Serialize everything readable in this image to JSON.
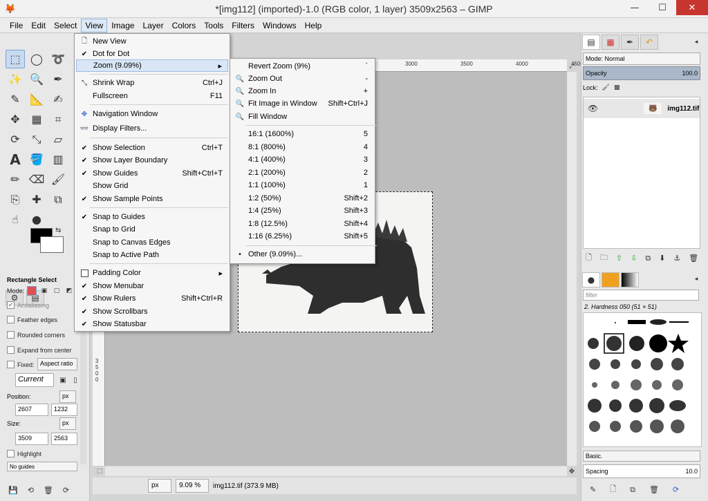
{
  "window": {
    "title": "*[img112] (imported)-1.0 (RGB color, 1 layer) 3509x2563 – GIMP",
    "app_icon": "gimp-icon"
  },
  "menubar": [
    "File",
    "Edit",
    "Select",
    "View",
    "Image",
    "Layer",
    "Colors",
    "Tools",
    "Filters",
    "Windows",
    "Help"
  ],
  "view_menu": [
    {
      "label": "New View",
      "check": "",
      "shortcut": "",
      "icon": "new-view-icon"
    },
    {
      "label": "Dot for Dot",
      "check": "✔",
      "shortcut": ""
    },
    {
      "label": "Zoom (9.09%)",
      "check": "",
      "shortcut": "",
      "submenu": true
    },
    {
      "label": "Shrink Wrap",
      "check": "",
      "shortcut": "Ctrl+J",
      "icon": "shrink-wrap-icon"
    },
    {
      "label": "Fullscreen",
      "check": "",
      "shortcut": "F11"
    },
    {
      "label": "Navigation Window",
      "check": "",
      "shortcut": "",
      "icon": "navigation-icon"
    },
    {
      "label": "Display Filters...",
      "check": "",
      "shortcut": "",
      "icon": "display-filters-icon"
    },
    {
      "label": "Show Selection",
      "check": "✔",
      "shortcut": "Ctrl+T"
    },
    {
      "label": "Show Layer Boundary",
      "check": "✔",
      "shortcut": ""
    },
    {
      "label": "Show Guides",
      "check": "✔",
      "shortcut": "Shift+Ctrl+T"
    },
    {
      "label": "Show Grid",
      "check": "",
      "shortcut": ""
    },
    {
      "label": "Show Sample Points",
      "check": "✔",
      "shortcut": ""
    },
    {
      "label": "Snap to Guides",
      "check": "✔",
      "shortcut": ""
    },
    {
      "label": "Snap to Grid",
      "check": "",
      "shortcut": ""
    },
    {
      "label": "Snap to Canvas Edges",
      "check": "",
      "shortcut": ""
    },
    {
      "label": "Snap to Active Path",
      "check": "",
      "shortcut": ""
    },
    {
      "label": "Padding Color",
      "check": "",
      "shortcut": "",
      "submenu": true
    },
    {
      "label": "Show Menubar",
      "check": "✔",
      "shortcut": ""
    },
    {
      "label": "Show Rulers",
      "check": "✔",
      "shortcut": "Shift+Ctrl+R"
    },
    {
      "label": "Show Scrollbars",
      "check": "✔",
      "shortcut": ""
    },
    {
      "label": "Show Statusbar",
      "check": "✔",
      "shortcut": ""
    }
  ],
  "zoom_menu": [
    {
      "label": "Revert Zoom (9%)",
      "shortcut": "`"
    },
    {
      "label": "Zoom Out",
      "shortcut": "-"
    },
    {
      "label": "Zoom In",
      "shortcut": "+"
    },
    {
      "label": "Fit Image in Window",
      "shortcut": "Shift+Ctrl+J"
    },
    {
      "label": "Fill Window",
      "shortcut": ""
    },
    {
      "label": "16:1  (1600%)",
      "shortcut": "5"
    },
    {
      "label": "8:1  (800%)",
      "shortcut": "4"
    },
    {
      "label": "4:1  (400%)",
      "shortcut": "3"
    },
    {
      "label": "2:1  (200%)",
      "shortcut": "2"
    },
    {
      "label": "1:1  (100%)",
      "shortcut": "1"
    },
    {
      "label": "1:2  (50%)",
      "shortcut": "Shift+2"
    },
    {
      "label": "1:4  (25%)",
      "shortcut": "Shift+3"
    },
    {
      "label": "1:8  (12.5%)",
      "shortcut": "Shift+4"
    },
    {
      "label": "1:16  (6.25%)",
      "shortcut": "Shift+5"
    },
    {
      "label": "Other (9.09%)...",
      "shortcut": "",
      "radio": "•"
    }
  ],
  "ruler": {
    "ticks": [
      "3000",
      "3500",
      "4000",
      "4500"
    ],
    "vticks": [
      "3",
      "5",
      "0",
      "0"
    ]
  },
  "tool_options": {
    "title": "Rectangle Select",
    "mode_label": "Mode:",
    "antialiasing": "Antialiasing",
    "feather": "Feather edges",
    "rounded": "Rounded corners",
    "expand": "Expand from center",
    "fixed": "Fixed:",
    "fixed_value": "Aspect ratio",
    "current": "Current",
    "position_label": "Position:",
    "pos_x": "2607",
    "pos_y": "1232",
    "size_label": "Size:",
    "size_w": "3509",
    "size_h": "2563",
    "unit": "px",
    "highlight": "Highlight",
    "guides": "No guides"
  },
  "status": {
    "unit": "px",
    "zoom": "9.09 %",
    "info": "img112.tif (373.9 MB)"
  },
  "layers": {
    "mode": "Mode: Normal",
    "opacity_label": "Opacity",
    "opacity_value": "100.0",
    "lock_label": "Lock:",
    "layer_name": "img112.tif"
  },
  "brushes": {
    "filter": "filter",
    "name": "2. Hardness 050 (51 × 51)",
    "preset": "Basic.",
    "spacing_label": "Spacing",
    "spacing_value": "10.0"
  }
}
